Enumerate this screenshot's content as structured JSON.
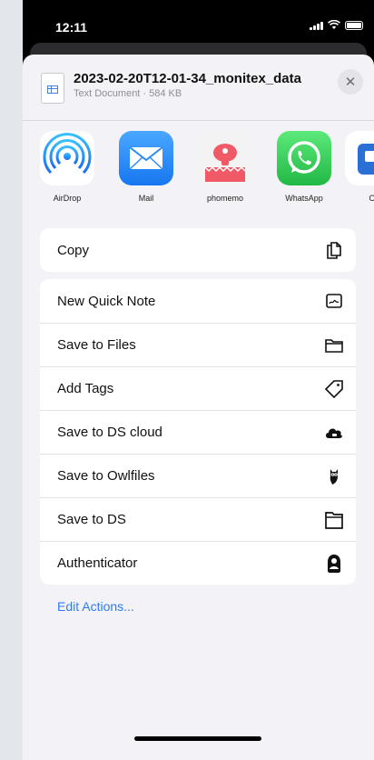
{
  "status": {
    "time": "12:11"
  },
  "file": {
    "name": "2023-02-20T12-01-34_monitex_data",
    "details": "Text Document · 584 KB",
    "close_symbol": "✕"
  },
  "apps": [
    {
      "label": "AirDrop",
      "icon": "airdrop-icon"
    },
    {
      "label": "Mail",
      "icon": "mail-icon"
    },
    {
      "label": "phomemo",
      "icon": "phomemo-icon"
    },
    {
      "label": "WhatsApp",
      "icon": "whatsapp-icon"
    },
    {
      "label": "O",
      "icon": "partial-app-icon"
    }
  ],
  "actions_primary": [
    {
      "label": "Copy",
      "icon": "copy-icon"
    }
  ],
  "actions_list": [
    {
      "label": "New Quick Note",
      "icon": "quick-note-icon"
    },
    {
      "label": "Save to Files",
      "icon": "folder-icon"
    },
    {
      "label": "Add Tags",
      "icon": "tag-icon"
    },
    {
      "label": "Save to DS cloud",
      "icon": "cloud-icon"
    },
    {
      "label": "Save to Owlfiles",
      "icon": "owl-icon"
    },
    {
      "label": "Save to DS",
      "icon": "folder-outline-icon"
    },
    {
      "label": "Authenticator",
      "icon": "authenticator-icon"
    }
  ],
  "edit_actions": "Edit Actions...",
  "colors": {
    "accent": "#2f7bf0",
    "sheet": "#f2f2f7",
    "whatsapp": "#25d366",
    "phomemo": "#f05a66"
  }
}
